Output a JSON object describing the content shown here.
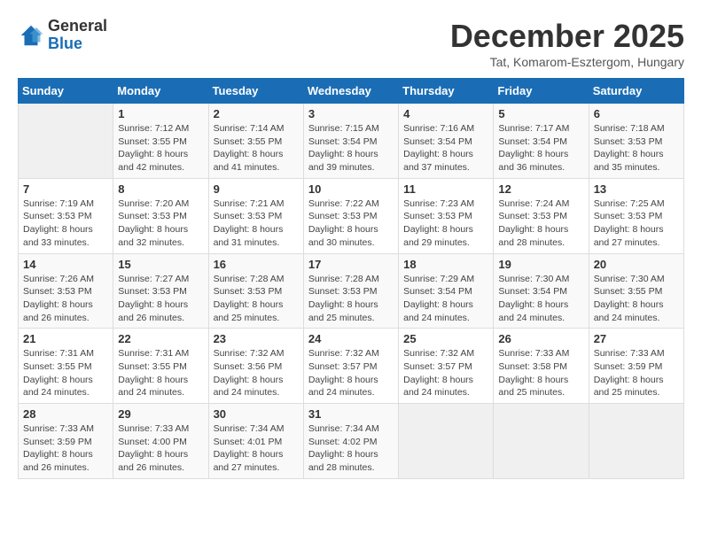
{
  "header": {
    "logo_general": "General",
    "logo_blue": "Blue",
    "month_title": "December 2025",
    "subtitle": "Tat, Komarom-Esztergom, Hungary"
  },
  "weekdays": [
    "Sunday",
    "Monday",
    "Tuesday",
    "Wednesday",
    "Thursday",
    "Friday",
    "Saturday"
  ],
  "weeks": [
    [
      {
        "day": "",
        "info": ""
      },
      {
        "day": "1",
        "info": "Sunrise: 7:12 AM\nSunset: 3:55 PM\nDaylight: 8 hours\nand 42 minutes."
      },
      {
        "day": "2",
        "info": "Sunrise: 7:14 AM\nSunset: 3:55 PM\nDaylight: 8 hours\nand 41 minutes."
      },
      {
        "day": "3",
        "info": "Sunrise: 7:15 AM\nSunset: 3:54 PM\nDaylight: 8 hours\nand 39 minutes."
      },
      {
        "day": "4",
        "info": "Sunrise: 7:16 AM\nSunset: 3:54 PM\nDaylight: 8 hours\nand 37 minutes."
      },
      {
        "day": "5",
        "info": "Sunrise: 7:17 AM\nSunset: 3:54 PM\nDaylight: 8 hours\nand 36 minutes."
      },
      {
        "day": "6",
        "info": "Sunrise: 7:18 AM\nSunset: 3:53 PM\nDaylight: 8 hours\nand 35 minutes."
      }
    ],
    [
      {
        "day": "7",
        "info": "Sunrise: 7:19 AM\nSunset: 3:53 PM\nDaylight: 8 hours\nand 33 minutes."
      },
      {
        "day": "8",
        "info": "Sunrise: 7:20 AM\nSunset: 3:53 PM\nDaylight: 8 hours\nand 32 minutes."
      },
      {
        "day": "9",
        "info": "Sunrise: 7:21 AM\nSunset: 3:53 PM\nDaylight: 8 hours\nand 31 minutes."
      },
      {
        "day": "10",
        "info": "Sunrise: 7:22 AM\nSunset: 3:53 PM\nDaylight: 8 hours\nand 30 minutes."
      },
      {
        "day": "11",
        "info": "Sunrise: 7:23 AM\nSunset: 3:53 PM\nDaylight: 8 hours\nand 29 minutes."
      },
      {
        "day": "12",
        "info": "Sunrise: 7:24 AM\nSunset: 3:53 PM\nDaylight: 8 hours\nand 28 minutes."
      },
      {
        "day": "13",
        "info": "Sunrise: 7:25 AM\nSunset: 3:53 PM\nDaylight: 8 hours\nand 27 minutes."
      }
    ],
    [
      {
        "day": "14",
        "info": "Sunrise: 7:26 AM\nSunset: 3:53 PM\nDaylight: 8 hours\nand 26 minutes."
      },
      {
        "day": "15",
        "info": "Sunrise: 7:27 AM\nSunset: 3:53 PM\nDaylight: 8 hours\nand 26 minutes."
      },
      {
        "day": "16",
        "info": "Sunrise: 7:28 AM\nSunset: 3:53 PM\nDaylight: 8 hours\nand 25 minutes."
      },
      {
        "day": "17",
        "info": "Sunrise: 7:28 AM\nSunset: 3:53 PM\nDaylight: 8 hours\nand 25 minutes."
      },
      {
        "day": "18",
        "info": "Sunrise: 7:29 AM\nSunset: 3:54 PM\nDaylight: 8 hours\nand 24 minutes."
      },
      {
        "day": "19",
        "info": "Sunrise: 7:30 AM\nSunset: 3:54 PM\nDaylight: 8 hours\nand 24 minutes."
      },
      {
        "day": "20",
        "info": "Sunrise: 7:30 AM\nSunset: 3:55 PM\nDaylight: 8 hours\nand 24 minutes."
      }
    ],
    [
      {
        "day": "21",
        "info": "Sunrise: 7:31 AM\nSunset: 3:55 PM\nDaylight: 8 hours\nand 24 minutes."
      },
      {
        "day": "22",
        "info": "Sunrise: 7:31 AM\nSunset: 3:55 PM\nDaylight: 8 hours\nand 24 minutes."
      },
      {
        "day": "23",
        "info": "Sunrise: 7:32 AM\nSunset: 3:56 PM\nDaylight: 8 hours\nand 24 minutes."
      },
      {
        "day": "24",
        "info": "Sunrise: 7:32 AM\nSunset: 3:57 PM\nDaylight: 8 hours\nand 24 minutes."
      },
      {
        "day": "25",
        "info": "Sunrise: 7:32 AM\nSunset: 3:57 PM\nDaylight: 8 hours\nand 24 minutes."
      },
      {
        "day": "26",
        "info": "Sunrise: 7:33 AM\nSunset: 3:58 PM\nDaylight: 8 hours\nand 25 minutes."
      },
      {
        "day": "27",
        "info": "Sunrise: 7:33 AM\nSunset: 3:59 PM\nDaylight: 8 hours\nand 25 minutes."
      }
    ],
    [
      {
        "day": "28",
        "info": "Sunrise: 7:33 AM\nSunset: 3:59 PM\nDaylight: 8 hours\nand 26 minutes."
      },
      {
        "day": "29",
        "info": "Sunrise: 7:33 AM\nSunset: 4:00 PM\nDaylight: 8 hours\nand 26 minutes."
      },
      {
        "day": "30",
        "info": "Sunrise: 7:34 AM\nSunset: 4:01 PM\nDaylight: 8 hours\nand 27 minutes."
      },
      {
        "day": "31",
        "info": "Sunrise: 7:34 AM\nSunset: 4:02 PM\nDaylight: 8 hours\nand 28 minutes."
      },
      {
        "day": "",
        "info": ""
      },
      {
        "day": "",
        "info": ""
      },
      {
        "day": "",
        "info": ""
      }
    ]
  ]
}
